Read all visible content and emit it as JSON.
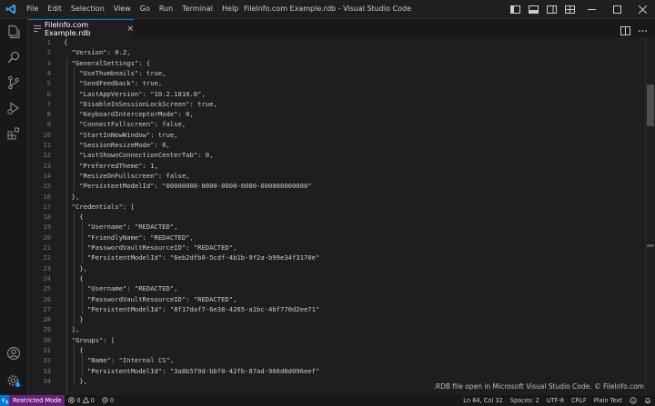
{
  "menu": [
    "File",
    "Edit",
    "Selection",
    "View",
    "Go",
    "Run",
    "Terminal",
    "Help"
  ],
  "window_title": "FileInfo.com Example.rdb - Visual Studio Code",
  "tab": {
    "label": "FileInfo.com Example.rdb",
    "close": "×"
  },
  "colors": {
    "accent": "#0078d4",
    "text": "#cccccc",
    "line_number": "#6e7681",
    "background": "#1e1e1e"
  },
  "activity_icons": [
    "explorer-icon",
    "search-icon",
    "source-control-icon",
    "run-debug-icon",
    "extensions-icon"
  ],
  "code_lines": [
    "{",
    "  \"Version\": 0.2,",
    "  \"GeneralSettings\": {",
    "    \"UseThumbnails\": true,",
    "    \"SendFeedback\": true,",
    "    \"LastAppVersion\": \"10.2.1810.0\",",
    "    \"DisableInSessionLockScreen\": true,",
    "    \"KeyboardInterceptorMode\": 0,",
    "    \"ConnectFullscreen\": false,",
    "    \"StartInNewWindow\": true,",
    "    \"SessionResizeMode\": 0,",
    "    \"LastShownConnectionCenterTab\": 0,",
    "    \"PreferredTheme\": 1,",
    "    \"ResizeOnFullscreen\": false,",
    "    \"PersistentModelId\": \"00000000-0000-0000-0000-000000000000\"",
    "  },",
    "  \"Credentials\": [",
    "    {",
    "      \"Username\": \"REDACTED\",",
    "      \"FriendlyName\": \"REDACTED\",",
    "      \"PasswordVaultResourceID\": \"REDACTED\",",
    "      \"PersistentModelId\": \"6eb2dfb8-5cdf-4b1b-9f2a-b99e34f3170e\"",
    "    },",
    "    {",
    "      \"Username\": \"REDACTED\",",
    "      \"PasswordVaultResourceID\": \"REDACTED\",",
    "      \"PersistentModelId\": \"8f17daf7-6e38-4265-a1bc-4bf770d2ee71\"",
    "    }",
    "  ],",
    "  \"Groups\": [",
    "    {",
    "      \"Name\": \"Internal CS\",",
    "      \"PersistentModelId\": \"3a8b5f9d-bbf0-42fb-87ad-966d0d096eef\"",
    "    },"
  ],
  "watermark": ".RDB file open in Microsoft Visual Studio Code. © FileInfo.com",
  "status": {
    "restricted": "Restricted Mode",
    "errors": "0",
    "warnings": "0",
    "ports": "0",
    "position": "Ln 84, Col 32",
    "spaces": "Spaces: 2",
    "encoding": "UTF-8",
    "eol": "CRLF",
    "language": "Plain Text"
  }
}
